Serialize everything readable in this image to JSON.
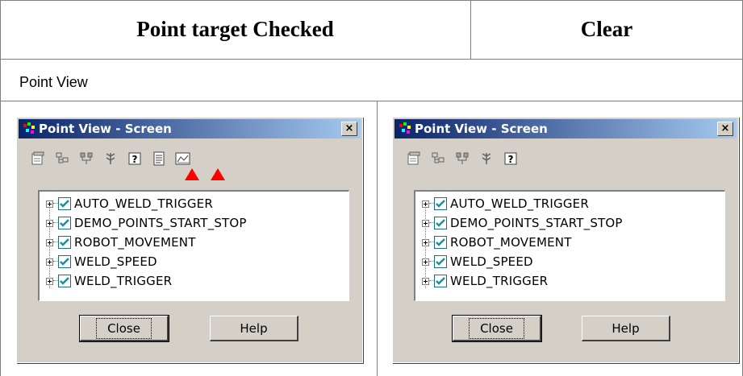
{
  "table": {
    "headers": [
      "Point target Checked",
      "Clear"
    ],
    "section_label": "Point View"
  },
  "dialogs": [
    {
      "title": "Point View - Screen",
      "close_glyph": "×",
      "toolbar_icons": [
        "properties-icon",
        "tree-structure-icon",
        "tree-network-icon",
        "tree-branch-icon",
        "help-icon",
        "point-list-icon",
        "trend-chart-icon"
      ],
      "items": [
        "AUTO_WELD_TRIGGER",
        "DEMO_POINTS_START_STOP",
        "ROBOT_MOVEMENT",
        "WELD_SPEED",
        "WELD_TRIGGER"
      ],
      "buttons": {
        "close": "Close",
        "help": "Help"
      },
      "highlight_arrows": 2
    },
    {
      "title": "Point View - Screen",
      "close_glyph": "×",
      "toolbar_icons": [
        "properties-icon",
        "tree-structure-icon",
        "tree-network-icon",
        "tree-branch-icon",
        "help-icon"
      ],
      "items": [
        "AUTO_WELD_TRIGGER",
        "DEMO_POINTS_START_STOP",
        "ROBOT_MOVEMENT",
        "WELD_SPEED",
        "WELD_TRIGGER"
      ],
      "buttons": {
        "close": "Close",
        "help": "Help"
      },
      "highlight_arrows": 0
    }
  ],
  "colors": {
    "title_gradient_start": "#0a246a",
    "title_gradient_end": "#a6caf0",
    "dialog_face": "#d4d0c8",
    "checkbox_check": "#1b8f9e",
    "arrow": "#ff0000"
  }
}
